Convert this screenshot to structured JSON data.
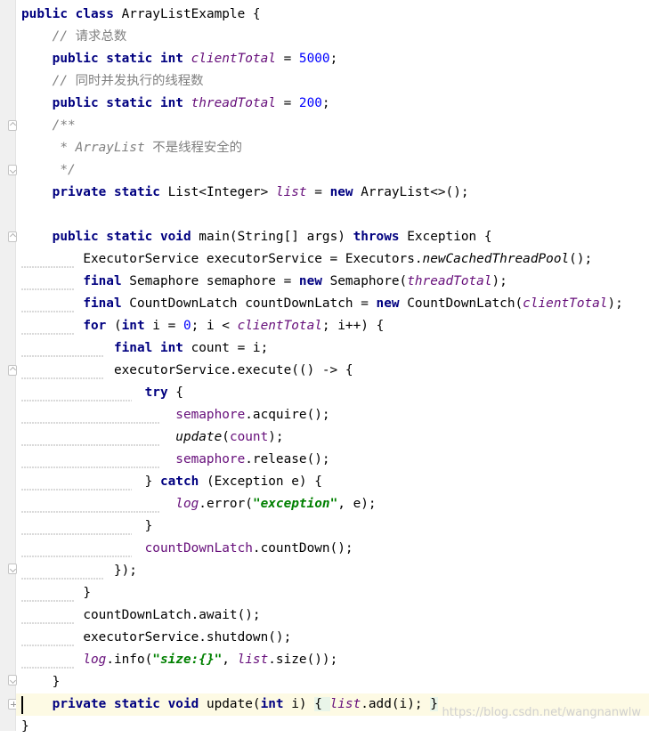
{
  "editor": {
    "lines": [
      {
        "indent": "",
        "tokens": [
          {
            "t": "public class ",
            "c": "kw"
          },
          {
            "t": "ArrayListExample {"
          }
        ]
      },
      {
        "indent": "    ",
        "tokens": [
          {
            "t": "// ",
            "c": "cm"
          },
          {
            "t": "请求总数",
            "c": "cmzh"
          }
        ]
      },
      {
        "indent": "    ",
        "tokens": [
          {
            "t": "public static int ",
            "c": "kw"
          },
          {
            "t": "clientTotal",
            "c": "fi"
          },
          {
            "t": " = "
          },
          {
            "t": "5000",
            "c": "num"
          },
          {
            "t": ";"
          }
        ]
      },
      {
        "indent": "    ",
        "tokens": [
          {
            "t": "// ",
            "c": "cm"
          },
          {
            "t": "同时并发执行的线程数",
            "c": "cmzh"
          }
        ]
      },
      {
        "indent": "    ",
        "tokens": [
          {
            "t": "public static int ",
            "c": "kw"
          },
          {
            "t": "threadTotal",
            "c": "fi"
          },
          {
            "t": " = "
          },
          {
            "t": "200",
            "c": "num"
          },
          {
            "t": ";"
          }
        ]
      },
      {
        "indent": "    ",
        "tokens": [
          {
            "t": "/**",
            "c": "cm"
          }
        ]
      },
      {
        "indent": "     ",
        "tokens": [
          {
            "t": "* ArrayList ",
            "c": "cm"
          },
          {
            "t": "不是线程安全的",
            "c": "cmzh"
          }
        ]
      },
      {
        "indent": "     ",
        "tokens": [
          {
            "t": "*/",
            "c": "cm"
          }
        ]
      },
      {
        "indent": "    ",
        "tokens": [
          {
            "t": "private static ",
            "c": "kw"
          },
          {
            "t": "List<Integer> "
          },
          {
            "t": "list",
            "c": "fi"
          },
          {
            "t": " = "
          },
          {
            "t": "new ",
            "c": "kw"
          },
          {
            "t": "ArrayList<>();"
          }
        ]
      },
      {
        "indent": "",
        "tokens": []
      },
      {
        "indent": "    ",
        "tokens": [
          {
            "t": "public static void ",
            "c": "kw"
          },
          {
            "t": "main(String[] args) "
          },
          {
            "t": "throws ",
            "c": "kw"
          },
          {
            "t": "Exception {"
          }
        ]
      },
      {
        "indent": "        ",
        "tokens": [
          {
            "t": "ExecutorService executorService = Executors."
          },
          {
            "t": "newCachedThreadPool",
            "c": "sti"
          },
          {
            "t": "();"
          }
        ]
      },
      {
        "indent": "        ",
        "tokens": [
          {
            "t": "final ",
            "c": "kw"
          },
          {
            "t": "Semaphore semaphore = "
          },
          {
            "t": "new ",
            "c": "kw"
          },
          {
            "t": "Semaphore("
          },
          {
            "t": "threadTotal",
            "c": "fi"
          },
          {
            "t": ");"
          }
        ]
      },
      {
        "indent": "        ",
        "tokens": [
          {
            "t": "final ",
            "c": "kw"
          },
          {
            "t": "CountDownLatch countDownLatch = "
          },
          {
            "t": "new ",
            "c": "kw"
          },
          {
            "t": "CountDownLatch("
          },
          {
            "t": "clientTotal",
            "c": "fi"
          },
          {
            "t": ");"
          }
        ]
      },
      {
        "indent": "        ",
        "tokens": [
          {
            "t": "for ",
            "c": "kw"
          },
          {
            "t": "("
          },
          {
            "t": "int ",
            "c": "kw"
          },
          {
            "t": "i = "
          },
          {
            "t": "0",
            "c": "num"
          },
          {
            "t": "; i < "
          },
          {
            "t": "clientTotal",
            "c": "fi"
          },
          {
            "t": "; i++) {"
          }
        ]
      },
      {
        "indent": "            ",
        "tokens": [
          {
            "t": "final int ",
            "c": "kw"
          },
          {
            "t": "count = i;"
          }
        ]
      },
      {
        "indent": "            ",
        "tokens": [
          {
            "t": "executorService.execute(() -> {"
          }
        ]
      },
      {
        "indent": "                ",
        "tokens": [
          {
            "t": "try ",
            "c": "kw"
          },
          {
            "t": "{"
          }
        ]
      },
      {
        "indent": "                    ",
        "tokens": [
          {
            "t": "semaphore",
            "c": "fp"
          },
          {
            "t": ".acquire();"
          }
        ]
      },
      {
        "indent": "                    ",
        "tokens": [
          {
            "t": "update",
            "c": "sti"
          },
          {
            "t": "("
          },
          {
            "t": "count",
            "c": "fp"
          },
          {
            "t": ");"
          }
        ]
      },
      {
        "indent": "                    ",
        "tokens": [
          {
            "t": "semaphore",
            "c": "fp"
          },
          {
            "t": ".release();"
          }
        ]
      },
      {
        "indent": "                ",
        "tokens": [
          {
            "t": "} "
          },
          {
            "t": "catch ",
            "c": "kw"
          },
          {
            "t": "(Exception e) {"
          }
        ]
      },
      {
        "indent": "                    ",
        "tokens": [
          {
            "t": "log",
            "c": "fi"
          },
          {
            "t": ".error("
          },
          {
            "t": "\"exception\"",
            "c": "st"
          },
          {
            "t": ", e);"
          }
        ]
      },
      {
        "indent": "                ",
        "tokens": [
          {
            "t": "}"
          }
        ]
      },
      {
        "indent": "                ",
        "tokens": [
          {
            "t": "countDownLatch",
            "c": "fp"
          },
          {
            "t": ".countDown();"
          }
        ]
      },
      {
        "indent": "            ",
        "tokens": [
          {
            "t": "});"
          }
        ]
      },
      {
        "indent": "        ",
        "tokens": [
          {
            "t": "}"
          }
        ]
      },
      {
        "indent": "        ",
        "tokens": [
          {
            "t": "countDownLatch.await();"
          }
        ]
      },
      {
        "indent": "        ",
        "tokens": [
          {
            "t": "executorService.shutdown();"
          }
        ]
      },
      {
        "indent": "        ",
        "tokens": [
          {
            "t": "log",
            "c": "fi"
          },
          {
            "t": ".info("
          },
          {
            "t": "\"size:{}\"",
            "c": "st"
          },
          {
            "t": ", "
          },
          {
            "t": "list",
            "c": "fi"
          },
          {
            "t": ".size());"
          }
        ]
      },
      {
        "indent": "    ",
        "tokens": [
          {
            "t": "}"
          }
        ]
      },
      {
        "indent": "    ",
        "tokens": [
          {
            "t": "private static void ",
            "c": "kw"
          },
          {
            "t": "update("
          },
          {
            "t": "int ",
            "c": "kw"
          },
          {
            "t": "i) "
          },
          {
            "t": "{ ",
            "c": "box"
          },
          {
            "t": "list",
            "c": "fi"
          },
          {
            "t": ".add(i); "
          },
          {
            "t": "}",
            "c": "box"
          }
        ]
      },
      {
        "indent": "",
        "tokens": [
          {
            "t": "}"
          }
        ]
      }
    ]
  },
  "watermark": "https://blog.csdn.net/wangnanwlw"
}
